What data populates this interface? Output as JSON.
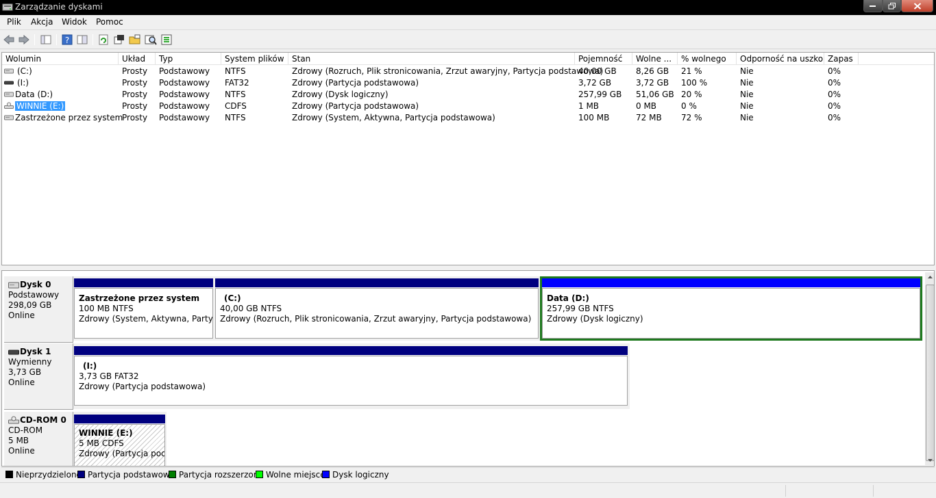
{
  "window": {
    "title": "Zarządzanie dyskami"
  },
  "menu": [
    "Plik",
    "Akcja",
    "Widok",
    "Pomoc"
  ],
  "toolbar": {
    "icons": [
      "back-icon",
      "forward-icon",
      "console-tree-icon",
      "help-icon",
      "properties-icon",
      "refresh-icon",
      "settings-icon",
      "open-icon",
      "search-icon",
      "export-icon"
    ]
  },
  "columns": [
    "Wolumin",
    "Układ",
    "Typ",
    "System plików",
    "Stan",
    "Pojemność",
    "Wolne ...",
    "% wolnego",
    "Odporność na uszko...",
    "Zapas"
  ],
  "volumes": [
    {
      "name": "(C:)",
      "layout": "Prosty",
      "type": "Podstawowy",
      "fs": "NTFS",
      "status": "Zdrowy (Rozruch, Plik stronicowania, Zrzut awaryjny, Partycja podstawowa)",
      "capacity": "40,00 GB",
      "free": "8,26 GB",
      "pct": "21 %",
      "fault": "Nie",
      "overhead": "0%"
    },
    {
      "name": "(I:)",
      "layout": "Prosty",
      "type": "Podstawowy",
      "fs": "FAT32",
      "status": "Zdrowy (Partycja podstawowa)",
      "capacity": "3,72 GB",
      "free": "3,72 GB",
      "pct": "100 %",
      "fault": "Nie",
      "overhead": "0%"
    },
    {
      "name": "Data (D:)",
      "layout": "Prosty",
      "type": "Podstawowy",
      "fs": "NTFS",
      "status": "Zdrowy (Dysk logiczny)",
      "capacity": "257,99 GB",
      "free": "51,06 GB",
      "pct": "20 %",
      "fault": "Nie",
      "overhead": "0%"
    },
    {
      "name": "WINNIE (E:)",
      "layout": "Prosty",
      "type": "Podstawowy",
      "fs": "CDFS",
      "status": "Zdrowy (Partycja podstawowa)",
      "capacity": "1 MB",
      "free": "0 MB",
      "pct": "0 %",
      "fault": "Nie",
      "overhead": "0%"
    },
    {
      "name": "Zastrzeżone przez system",
      "layout": "Prosty",
      "type": "Podstawowy",
      "fs": "NTFS",
      "status": "Zdrowy (System, Aktywna, Partycja podstawowa)",
      "capacity": "100 MB",
      "free": "72 MB",
      "pct": "72 %",
      "fault": "Nie",
      "overhead": "0%"
    }
  ],
  "disks": [
    {
      "name": "Dysk 0",
      "kind": "Podstawowy",
      "size": "298,09 GB",
      "state": "Online",
      "partitions": [
        {
          "name": "Zastrzeżone przez system",
          "size": "100 MB NTFS",
          "status": "Zdrowy (System, Aktywna, Partycja p"
        },
        {
          "name": "(C:)",
          "size": "40,00 GB NTFS",
          "status": "Zdrowy (Rozruch, Plik stronicowania, Zrzut awaryjny, Partycja podstawowa)"
        },
        {
          "name": "Data  (D:)",
          "size": "257,99 GB NTFS",
          "status": "Zdrowy (Dysk logiczny)"
        }
      ]
    },
    {
      "name": "Dysk 1",
      "kind": "Wymienny",
      "size": "3,73 GB",
      "state": "Online",
      "partitions": [
        {
          "name": "(I:)",
          "size": "3,73 GB FAT32",
          "status": "Zdrowy (Partycja podstawowa)"
        }
      ]
    },
    {
      "name": "CD-ROM 0",
      "kind": "CD-ROM",
      "size": "5 MB",
      "state": "Online",
      "partitions": [
        {
          "name": "WINNIE  (E:)",
          "size": "5 MB CDFS",
          "status": "Zdrowy (Partycja podst"
        }
      ]
    }
  ],
  "legend": [
    {
      "label": "Nieprzydzielone",
      "color": "#000000"
    },
    {
      "label": "Partycja podstawowa",
      "color": "#00007f"
    },
    {
      "label": "Partycja rozszerzona",
      "color": "#007f00"
    },
    {
      "label": "Wolne miejsce",
      "color": "#00ff00"
    },
    {
      "label": "Dysk logiczny",
      "color": "#0000ff"
    }
  ]
}
